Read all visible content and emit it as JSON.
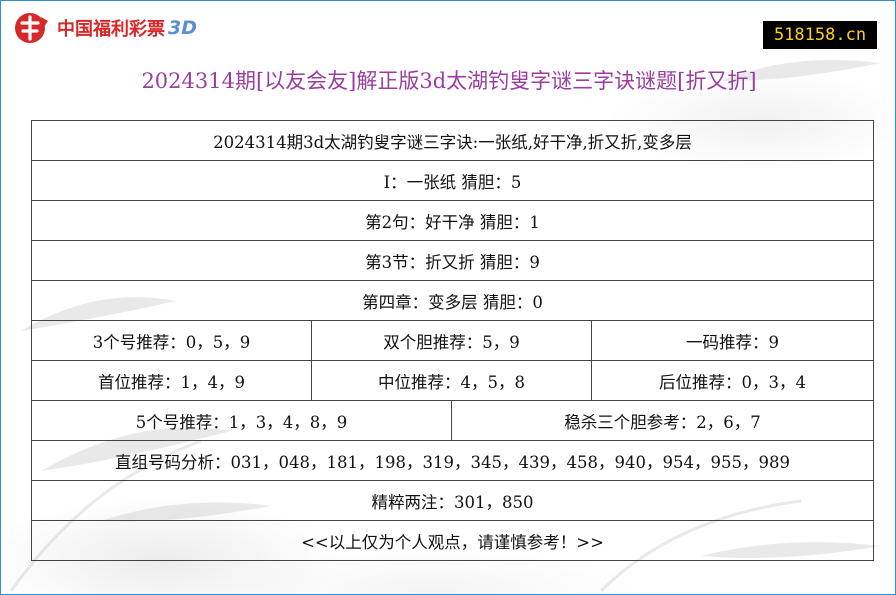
{
  "logo": {
    "text": "中国福利彩票",
    "suffix": "3D"
  },
  "badge": "518158.cn",
  "title": "2024314期[以友会友]解正版3d太湖钓叟字谜三字诀谜题[折又折]",
  "rows": {
    "r1": "2024314期3d太湖钓叟字谜三字诀:一张纸,好干净,折又折,变多层",
    "r2": "I：一张纸 猜胆：5",
    "r3": "第2句：好干净 猜胆：1",
    "r4": "第3节：折又折 猜胆：9",
    "r5": "第四章：变多层 猜胆：0",
    "r6": [
      "3个号推荐：0，5，9",
      "双个胆推荐：5，9",
      "一码推荐：9"
    ],
    "r7": [
      "首位推荐：1，4，9",
      "中位推荐：4，5，8",
      "后位推荐：0，3，4"
    ],
    "r8": [
      "5个号推荐：1，3，4，8，9",
      "稳杀三个胆参考：2，6，7"
    ],
    "r9": "直组号码分析：031，048，181，198，319，345，439，458，940，954，955，989",
    "r10": "精粹两注：301，850",
    "r11": "<<以上仅为个人观点，请谨慎参考！>>"
  },
  "colors": {
    "title": "#9b3d9e",
    "logo_red": "#d62828",
    "badge_bg": "#000000",
    "badge_text": "#ffd21a",
    "border": "#2f8fd6"
  }
}
